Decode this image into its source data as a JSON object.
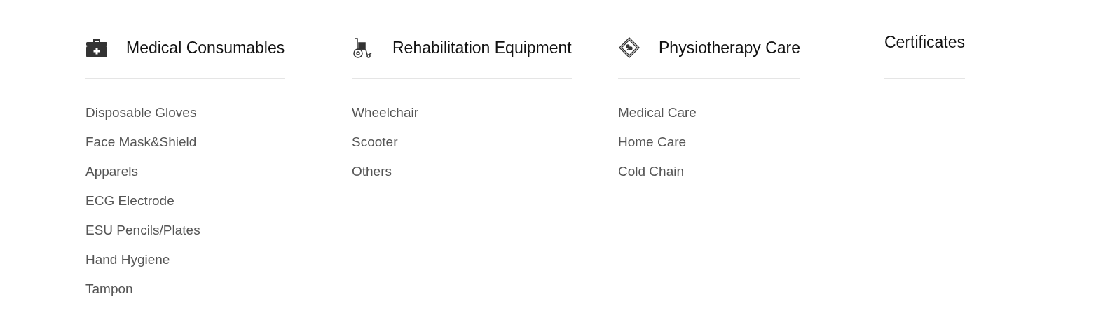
{
  "columns": [
    {
      "heading": "Medical Consumables",
      "kind": "kit",
      "items": [
        "Disposable Gloves",
        "Face Mask&Shield",
        "Apparels",
        "ECG Electrode",
        "ESU Pencils/Plates",
        "Hand Hygiene",
        "Tampon"
      ]
    },
    {
      "heading": "Rehabilitation Equipment",
      "kind": "wheelchair",
      "items": [
        "Wheelchair",
        "Scooter",
        "Others"
      ]
    },
    {
      "heading": "Physiotherapy Care",
      "kind": "pack",
      "items": [
        "Medical Care",
        "Home Care",
        "Cold Chain"
      ]
    },
    {
      "heading": "Certificates",
      "kind": "none"
    }
  ]
}
